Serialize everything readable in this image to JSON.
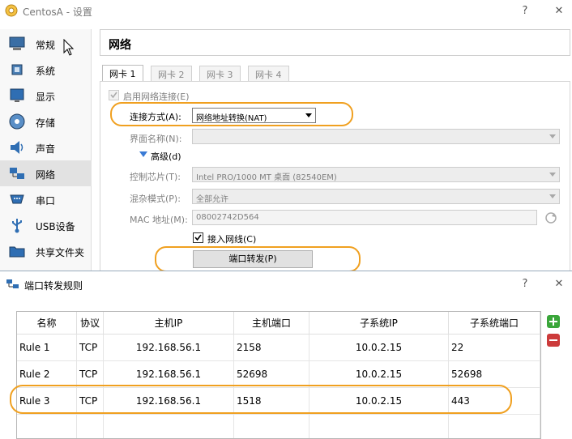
{
  "window": {
    "title": "CentosA - 设置",
    "help": "?",
    "close": "✕"
  },
  "sidebar": {
    "items": [
      {
        "label": "常规"
      },
      {
        "label": "系统"
      },
      {
        "label": "显示"
      },
      {
        "label": "存储"
      },
      {
        "label": "声音"
      },
      {
        "label": "网络"
      },
      {
        "label": "串口"
      },
      {
        "label": "USB设备"
      },
      {
        "label": "共享文件夹"
      }
    ],
    "selected": "网络"
  },
  "page": {
    "title": "网络",
    "tabs": [
      {
        "label": "网卡 1"
      },
      {
        "label": "网卡 2"
      },
      {
        "label": "网卡 3"
      },
      {
        "label": "网卡 4"
      }
    ],
    "enable_label": "启用网络连接(E)",
    "attach_label": "连接方式(A):",
    "attach_value": "网络地址转换(NAT)",
    "name_label": "界面名称(N):",
    "name_value": "",
    "advanced_label": "高级(d)",
    "adapter_label": "控制芯片(T):",
    "adapter_value": "Intel PRO/1000 MT 桌面 (82540EM)",
    "promisc_label": "混杂模式(P):",
    "promisc_value": "全部允许",
    "mac_label": "MAC 地址(M):",
    "mac_value": "08002742D564",
    "cable_label": "接入网线(C)",
    "port_forward_button": "端口转发(P)"
  },
  "dialog": {
    "title": "端口转发规则",
    "help": "?",
    "close": "✕",
    "columns": [
      "名称",
      "协议",
      "主机IP",
      "主机端口",
      "子系统IP",
      "子系统端口"
    ],
    "rows": [
      [
        "Rule 1",
        "TCP",
        "192.168.56.1",
        "2158",
        "10.0.2.15",
        "22"
      ],
      [
        "Rule 2",
        "TCP",
        "192.168.56.1",
        "52698",
        "10.0.2.15",
        "52698"
      ],
      [
        "Rule 3",
        "TCP",
        "192.168.56.1",
        "1518",
        "10.0.2.15",
        "443"
      ]
    ]
  },
  "colors": {
    "highlight": "#f0a020",
    "add_icon": "#2e9b2e",
    "remove_icon": "#c03030"
  }
}
